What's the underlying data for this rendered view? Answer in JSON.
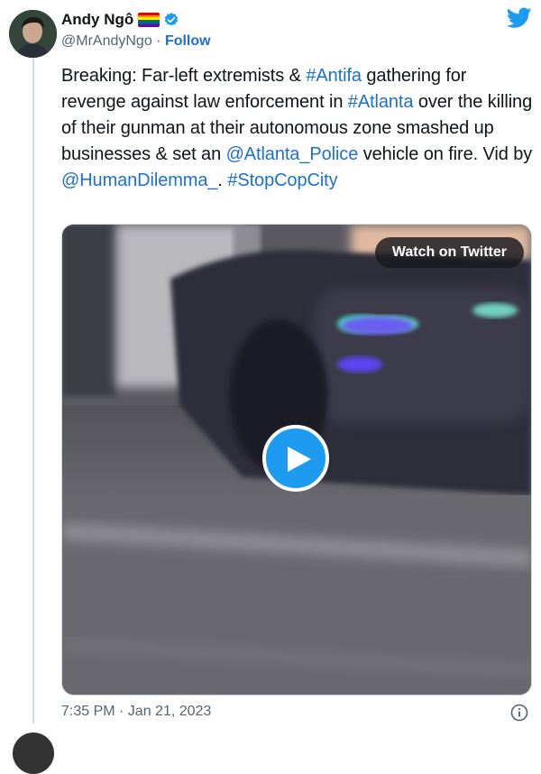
{
  "author": {
    "name": "Andy Ngô",
    "handle": "@MrAndyNgo",
    "separator": " · ",
    "follow_label": "Follow"
  },
  "tweet": {
    "segments": [
      {
        "text": "Breaking: Far-left extremists & ",
        "type": "text"
      },
      {
        "text": "#Antifa",
        "type": "link"
      },
      {
        "text": " gathering for revenge against law enforcement in ",
        "type": "text"
      },
      {
        "text": "#Atlanta",
        "type": "link"
      },
      {
        "text": " over the killing of their gunman at their autonomous zone smashed up businesses & set an ",
        "type": "text"
      },
      {
        "text": "@Atlanta_Police",
        "type": "link"
      },
      {
        "text": " vehicle on fire. Vid by ",
        "type": "text"
      },
      {
        "text": "@HumanDilemma_",
        "type": "link"
      },
      {
        "text": ". ",
        "type": "text"
      },
      {
        "text": "#StopCopCity",
        "type": "link"
      }
    ]
  },
  "video": {
    "watch_label": "Watch on Twitter"
  },
  "footer": {
    "timestamp": "7:35 PM · Jan 21, 2023"
  },
  "icons": {
    "logo": "twitter-bird-icon",
    "verified": "verified-badge-icon",
    "flag": "rainbow-flag-icon",
    "play": "play-icon",
    "info": "info-icon"
  },
  "colors": {
    "link": "#1d6fd1",
    "twitter_blue": "#1d9bf0",
    "secondary_text": "#536471"
  }
}
